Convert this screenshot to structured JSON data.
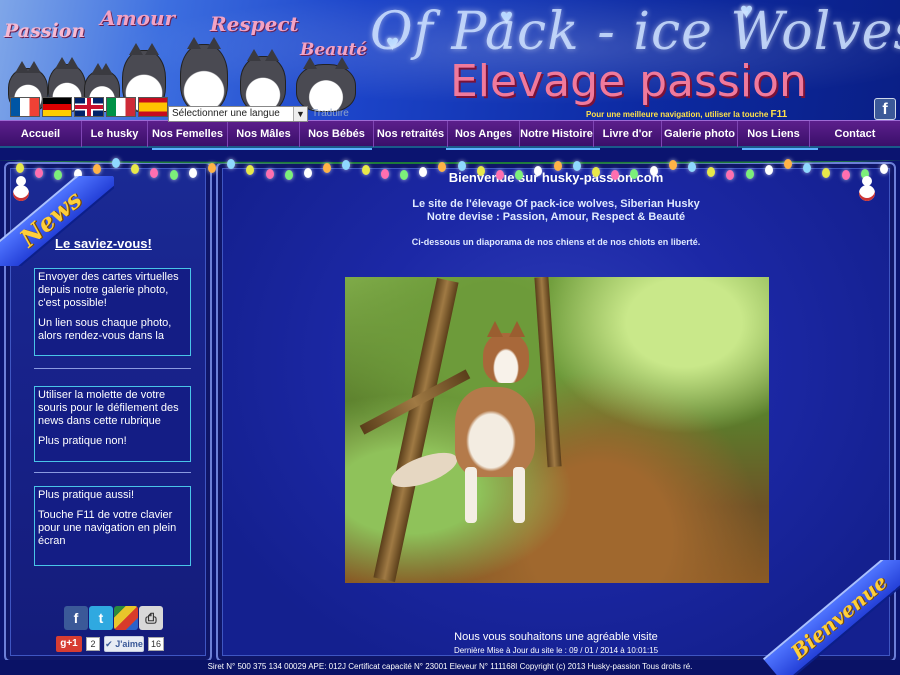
{
  "header": {
    "script_words": [
      "Passion",
      "Amour",
      "Respect",
      "Beauté"
    ],
    "title_line1": "Of Pack - ice Wolves",
    "title_line2": "Elevage passion",
    "language_select": {
      "value": "Sélectionner une langue"
    },
    "translate_label": "Traduire",
    "f11_hint_prefix": "Pour une meilleure navigation, utiliser la touche",
    "f11_key": "F11",
    "flags": [
      "flag-fr-icon",
      "flag-de-icon",
      "flag-uk-icon",
      "flag-it-icon",
      "flag-es-icon"
    ]
  },
  "nav": {
    "items": [
      {
        "label": "Accueil"
      },
      {
        "label": "Le husky"
      },
      {
        "label": "Nos Femelles"
      },
      {
        "label": "Nos Mâles"
      },
      {
        "label": "Nos Bébés"
      },
      {
        "label": "Nos retraités"
      },
      {
        "label": "Nos Anges"
      },
      {
        "label": "Notre Histoire"
      },
      {
        "label": "Livre d'or"
      },
      {
        "label": "Galerie photo"
      },
      {
        "label": "Nos Liens"
      },
      {
        "label": "Contact"
      }
    ]
  },
  "sidebar": {
    "ribbon": "News",
    "heading": "Le saviez-vous!",
    "box1_p1": "Envoyer des cartes virtuelles depuis notre galerie photo, c'est possible!",
    "box1_p2": "Un lien sous chaque photo, alors rendez-vous dans la",
    "box2_p1": "Utiliser la molette de votre souris pour le défilement des news dans cette rubrique",
    "box2_p2": "Plus pratique non!",
    "box3_p1": "Plus pratique aussi!",
    "box3_p2": "Touche F11 de votre clavier pour une navigation en plein écran",
    "social": {
      "gplus_label": "g+1",
      "gplus_count": "2",
      "like_label": "J'aime",
      "like_count": "16"
    }
  },
  "main": {
    "welcome": "Bienvenue sur husky-passion.com",
    "intro_line1": "Le site de l'élevage Of pack-ice wolves, Siberian Husky",
    "intro_line2": "Notre devise : Passion, Amour, Respect & Beauté",
    "intro_line3": "Ci-dessous un diaporama de nos chiens et de nos chiots en liberté.",
    "ribbon": "Bienvenue",
    "farewell": "Nous vous souhaitons une agréable visite",
    "last_update": "Dernière Mise à Jour du site le : 09 / 01 / 2014 à 10:01:15"
  },
  "footer": {
    "text": "Siret N° 500 375 134 00029 APE: 012J Certificat capacité N° 23001 Eleveur N° 111168I  Copyright (c) 2013 Husky-passion Tous droits ré."
  },
  "colors": {
    "nav_bg": "#3a0f6a",
    "panel_bg": "#1c28a6",
    "ribbon_text": "#ffcf3a",
    "title_pink": "#f07a9c"
  }
}
